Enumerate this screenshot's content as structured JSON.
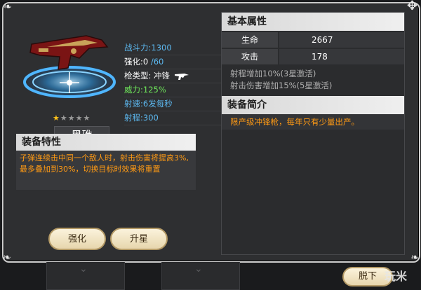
{
  "weapon": {
    "name": "黑礁",
    "stars_total": 5,
    "stars_filled": 1,
    "stats": {
      "combat_power": "战斗力:1300",
      "enhance_label": "强化:0",
      "enhance_max": " /60",
      "gun_type": "枪类型: 冲锋",
      "power": "威力:125%",
      "fire_rate": "射速:6发每秒",
      "range": "射程:300"
    }
  },
  "feature": {
    "title": "装备特性",
    "description": "子弹连续击中同一个敌人时，射击伤害将提高3%,最多叠加到30%，切换目标时效果将重置"
  },
  "buttons": {
    "enhance": "强化",
    "star_up": "升星",
    "unequip": "脱下"
  },
  "basic_attributes": {
    "title": "基本属性",
    "rows": [
      {
        "label": "生命",
        "value": "2667"
      },
      {
        "label": "攻击",
        "value": "178"
      }
    ],
    "bonuses": [
      "射程增加10%(3星激活)",
      "射击伤害增加15%(5星激活)"
    ]
  },
  "summary": {
    "title": "装备简介",
    "text": "限产级冲锋枪，每年只有少量出产。"
  },
  "watermark": "玩米",
  "colors": {
    "stat_blue": "#5dbaf2",
    "power_green": "#6ee65a",
    "orange_text": "#ff9a14",
    "star_gold": "#ffc21a"
  },
  "icons": {
    "gun_type": "gun-icon",
    "star": "star-icon",
    "corner": "ornament-icon"
  }
}
